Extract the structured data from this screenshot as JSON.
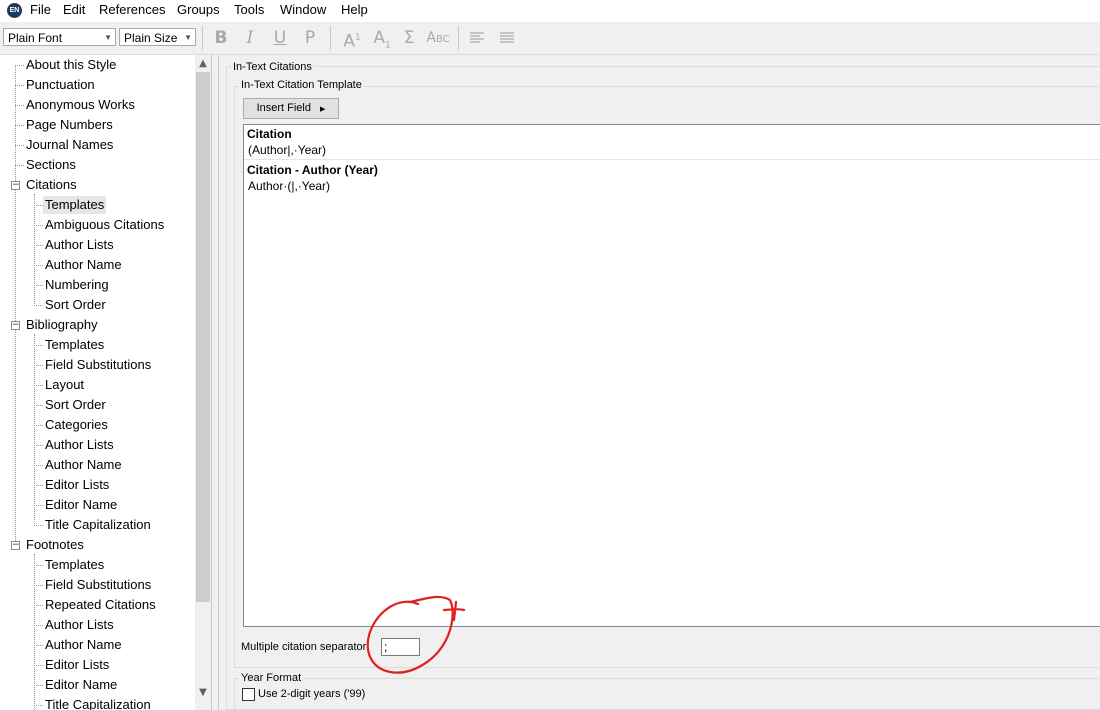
{
  "app": {
    "icon_text": "EN"
  },
  "menu": [
    "File",
    "Edit",
    "References",
    "Groups",
    "Tools",
    "Window",
    "Help"
  ],
  "toolbar": {
    "font_value": "Plain Font",
    "size_value": "Plain Size",
    "bold": "B",
    "italic": "I",
    "underline": "U",
    "plain": "P",
    "superscript": "A",
    "superscript_sub": "1",
    "subscript": "A",
    "subscript_sub": "1",
    "symbol": "Σ",
    "smallcaps": "Abc"
  },
  "tree": {
    "top": [
      "About this Style",
      "Punctuation",
      "Anonymous Works",
      "Page Numbers",
      "Journal Names",
      "Sections"
    ],
    "citations": {
      "label": "Citations",
      "children": [
        "Templates",
        "Ambiguous Citations",
        "Author Lists",
        "Author Name",
        "Numbering",
        "Sort Order"
      ]
    },
    "bibliography": {
      "label": "Bibliography",
      "children": [
        "Templates",
        "Field Substitutions",
        "Layout",
        "Sort Order",
        "Categories",
        "Author Lists",
        "Author Name",
        "Editor Lists",
        "Editor Name",
        "Title Capitalization"
      ]
    },
    "footnotes": {
      "label": "Footnotes",
      "children": [
        "Templates",
        "Field Substitutions",
        "Repeated Citations",
        "Author Lists",
        "Author Name",
        "Editor Lists",
        "Editor Name",
        "Title Capitalization"
      ]
    }
  },
  "main": {
    "section_title": "In-Text Citations",
    "template_group": "In-Text Citation Template",
    "insert_field": "Insert Field",
    "citation_heading": "Citation",
    "citation_template": "(Author|,·Year)",
    "citation_author_year_heading": "Citation - Author (Year)",
    "citation_author_year_template": "Author·(|,·Year)",
    "separator_label": "Multiple citation separator:",
    "separator_value": ";",
    "year_group": "Year Format",
    "year_checkbox_label": "Use 2-digit years ('99)"
  },
  "colors": {
    "annotation": "#e0201c"
  }
}
